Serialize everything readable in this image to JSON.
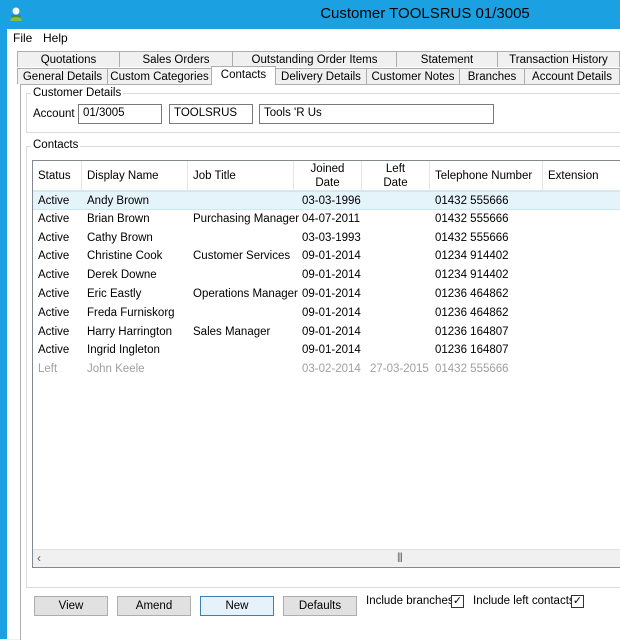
{
  "window": {
    "title": "Customer TOOLSRUS 01/3005"
  },
  "menu": {
    "file": "File",
    "help": "Help"
  },
  "tabs_row1": [
    "Quotations",
    "Sales Orders",
    "Outstanding Order Items",
    "Statement",
    "Transaction History"
  ],
  "tabs_row2": [
    "General Details",
    "Custom Categories",
    "Contacts",
    "Delivery Details",
    "Customer Notes",
    "Branches",
    "Account Details"
  ],
  "active_tab": "Contacts",
  "customer_details": {
    "group_label": "Customer Details",
    "account_label": "Account",
    "account_number": "01/3005",
    "account_code": "TOOLSRUS",
    "account_name": "Tools 'R Us"
  },
  "contacts": {
    "group_label": "Contacts",
    "columns": {
      "status": "Status",
      "display_name": "Display Name",
      "job_title": "Job Title",
      "joined_1": "Joined",
      "joined_2": "Date",
      "left_1": "Left",
      "left_2": "Date",
      "telephone": "Telephone Number",
      "extension": "Extension"
    },
    "rows": [
      {
        "status": "Active",
        "name": "Andy Brown",
        "job": "",
        "joined": "03-03-1996",
        "left": "",
        "phone": "01432 555666",
        "ext": ""
      },
      {
        "status": "Active",
        "name": "Brian Brown",
        "job": "Purchasing Manager",
        "joined": "04-07-2011",
        "left": "",
        "phone": "01432 555666",
        "ext": ""
      },
      {
        "status": "Active",
        "name": "Cathy Brown",
        "job": "",
        "joined": "03-03-1993",
        "left": "",
        "phone": "01432 555666",
        "ext": ""
      },
      {
        "status": "Active",
        "name": "Christine Cook",
        "job": "Customer Services",
        "joined": "09-01-2014",
        "left": "",
        "phone": "01234 914402",
        "ext": ""
      },
      {
        "status": "Active",
        "name": "Derek Downe",
        "job": "",
        "joined": "09-01-2014",
        "left": "",
        "phone": "01234 914402",
        "ext": ""
      },
      {
        "status": "Active",
        "name": "Eric Eastly",
        "job": "Operations Manager",
        "joined": "09-01-2014",
        "left": "",
        "phone": "01236 464862",
        "ext": ""
      },
      {
        "status": "Active",
        "name": "Freda Furniskorg",
        "job": "",
        "joined": "09-01-2014",
        "left": "",
        "phone": "01236 464862",
        "ext": ""
      },
      {
        "status": "Active",
        "name": "Harry Harrington",
        "job": "Sales Manager",
        "joined": "09-01-2014",
        "left": "",
        "phone": "01236 164807",
        "ext": ""
      },
      {
        "status": "Active",
        "name": "Ingrid Ingleton",
        "job": "",
        "joined": "09-01-2014",
        "left": "",
        "phone": "01236 164807",
        "ext": ""
      },
      {
        "status": "Left",
        "name": "John Keele",
        "job": "",
        "joined": "03-02-2014",
        "left": "27-03-2015",
        "phone": "01432 555666",
        "ext": ""
      }
    ]
  },
  "buttons": {
    "view": "View",
    "amend": "Amend",
    "new": "New",
    "defaults": "Defaults"
  },
  "options": {
    "include_branches": "Include branches",
    "include_branches_checked": true,
    "include_left": "Include left contacts",
    "include_left_checked": true
  },
  "colors": {
    "titlebar": "#1ba1e2",
    "selection": "#e5f3fb",
    "left_text": "#a0a0a0"
  },
  "icons": {
    "app": "user-app-icon",
    "scroll_left": "chevron-left-icon",
    "check": "checkmark-icon"
  }
}
